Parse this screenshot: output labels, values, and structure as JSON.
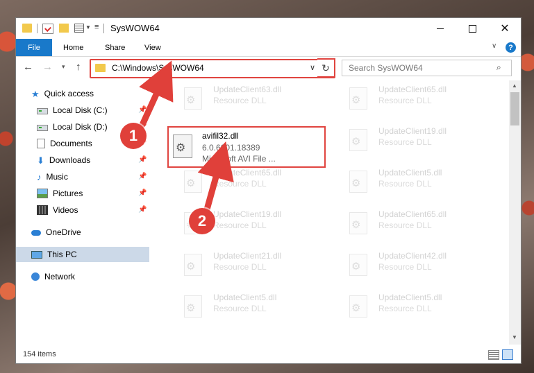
{
  "titlebar": {
    "title": "SysWOW64",
    "minimize_icon": "minimize-icon",
    "maximize_icon": "maximize-icon",
    "close_glyph": "✕"
  },
  "ribbon": {
    "tabs": [
      "File",
      "Home",
      "Share",
      "View"
    ],
    "help": "?"
  },
  "nav": {
    "back": "←",
    "forward": "→",
    "recent": "▾",
    "up": "↑",
    "address": "C:\\Windows\\SysWOW64",
    "address_drop": "∨",
    "refresh": "↻",
    "search_placeholder": "Search SysWOW64"
  },
  "sidebar": {
    "items": [
      {
        "label": "Quick access",
        "icon": "star-icon"
      },
      {
        "label": "Local Disk (C:)",
        "icon": "drive-icon",
        "pinned": true
      },
      {
        "label": "Local Disk (D:)",
        "icon": "drive-icon",
        "pinned": true
      },
      {
        "label": "Documents",
        "icon": "documents-icon",
        "pinned": true
      },
      {
        "label": "Downloads",
        "icon": "downloads-icon",
        "pinned": true
      },
      {
        "label": "Music",
        "icon": "music-icon",
        "pinned": true
      },
      {
        "label": "Pictures",
        "icon": "pictures-icon",
        "pinned": true
      },
      {
        "label": "Videos",
        "icon": "videos-icon",
        "pinned": true
      },
      {
        "label": "OneDrive",
        "icon": "onedrive-icon"
      },
      {
        "label": "This PC",
        "icon": "this-pc-icon",
        "selected": true
      },
      {
        "label": "Network",
        "icon": "network-icon"
      }
    ]
  },
  "files": {
    "left_column": [
      {
        "name": "UpdateClient63.dll",
        "desc": "Resource DLL"
      },
      {
        "name": "UpdateClient65.dll",
        "desc": "Resource DLL"
      },
      {
        "name": "UpdateClient19.dll",
        "desc": "Resource DLL"
      },
      {
        "name": "UpdateClient21.dll",
        "desc": "Resource DLL"
      },
      {
        "name": "UpdateClient5.dll",
        "desc": "Resource DLL"
      }
    ],
    "right_column": [
      {
        "name": "UpdateClient65.dll",
        "desc": "Resource DLL"
      },
      {
        "name": "UpdateClient19.dll",
        "desc": "Resource DLL"
      },
      {
        "name": "UpdateClient5.dll",
        "desc": "Resource DLL"
      },
      {
        "name": "UpdateClient65.dll",
        "desc": "Resource DLL"
      },
      {
        "name": "UpdateClient42.dll",
        "desc": "Resource DLL"
      },
      {
        "name": "UpdateClient5.dll",
        "desc": "Resource DLL"
      }
    ],
    "highlighted": {
      "name": "avifil32.dll",
      "version": "6.0.6001.18389",
      "description": "Microsoft AVI File ..."
    }
  },
  "status": {
    "count": "154 items"
  },
  "annotations": {
    "step1": "1",
    "step2": "2",
    "accent": "#e0403a"
  },
  "colors": {
    "file_tab": "#1979ca",
    "selection": "#ccd9e8",
    "highlight_border": "#e0443f"
  }
}
